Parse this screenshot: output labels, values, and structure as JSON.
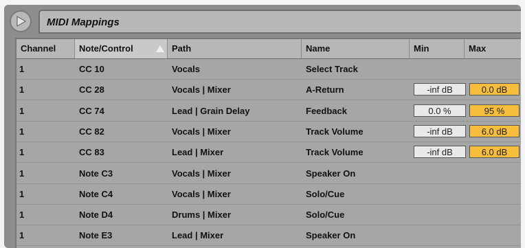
{
  "window": {
    "title": "MIDI Mappings"
  },
  "columns": [
    {
      "label": "Channel"
    },
    {
      "label": "Note/Control"
    },
    {
      "label": "Path"
    },
    {
      "label": "Name"
    },
    {
      "label": "Min"
    },
    {
      "label": "Max"
    }
  ],
  "sort": {
    "column": "Note/Control",
    "direction": "ascending",
    "icon": "sort-arrow-icon"
  },
  "colors": {
    "max_value_bg": "#f7be3e",
    "min_value_bg": "#e9e9e9",
    "panel_bg": "#a6a6a6"
  },
  "rows": [
    {
      "channel": "1",
      "note_control": "CC 10",
      "path": "Vocals",
      "name": "Select Track",
      "min": "",
      "max": ""
    },
    {
      "channel": "1",
      "note_control": "CC 28",
      "path": "Vocals | Mixer",
      "name": "A-Return",
      "min": "-inf dB",
      "max": "0.0 dB"
    },
    {
      "channel": "1",
      "note_control": "CC 74",
      "path": "Lead | Grain Delay",
      "name": "Feedback",
      "min": "0.0 %",
      "max": "95 %"
    },
    {
      "channel": "1",
      "note_control": "CC 82",
      "path": "Vocals | Mixer",
      "name": "Track Volume",
      "min": "-inf dB",
      "max": "6.0 dB"
    },
    {
      "channel": "1",
      "note_control": "CC 83",
      "path": "Lead | Mixer",
      "name": "Track Volume",
      "min": "-inf dB",
      "max": "6.0 dB"
    },
    {
      "channel": "1",
      "note_control": "Note C3",
      "path": "Vocals | Mixer",
      "name": "Speaker On",
      "min": "",
      "max": ""
    },
    {
      "channel": "1",
      "note_control": "Note C4",
      "path": "Vocals | Mixer",
      "name": "Solo/Cue",
      "min": "",
      "max": ""
    },
    {
      "channel": "1",
      "note_control": "Note D4",
      "path": "Drums | Mixer",
      "name": "Solo/Cue",
      "min": "",
      "max": ""
    },
    {
      "channel": "1",
      "note_control": "Note E3",
      "path": "Lead | Mixer",
      "name": "Speaker On",
      "min": "",
      "max": ""
    }
  ]
}
